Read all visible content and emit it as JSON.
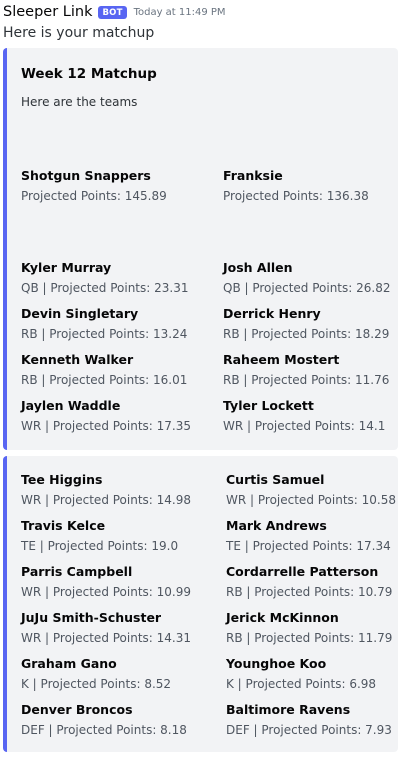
{
  "message": {
    "author": "Sleeper Link",
    "tag": "BOT",
    "timestamp": "Today at 11:49 PM",
    "content": "Here is your matchup",
    "accent_color": "#5865f2"
  },
  "embed1": {
    "title": "Week 12 Matchup",
    "description": "Here are the teams",
    "teams": [
      {
        "name": "Shotgun Snappers",
        "value": "Projected Points: 145.89"
      },
      {
        "name": "Franksie",
        "value": "Projected Points: 136.38"
      }
    ],
    "players_left": [
      {
        "name": "Kyler Murray",
        "value": "QB | Projected Points: 23.31"
      },
      {
        "name": "Devin Singletary",
        "value": "RB | Projected Points: 13.24"
      },
      {
        "name": "Kenneth Walker",
        "value": "RB | Projected Points: 16.01"
      },
      {
        "name": "Jaylen Waddle",
        "value": "WR | Projected Points: 17.35"
      }
    ],
    "players_right": [
      {
        "name": "Josh Allen",
        "value": "QB | Projected Points: 26.82"
      },
      {
        "name": "Derrick Henry",
        "value": "RB | Projected Points: 18.29"
      },
      {
        "name": "Raheem Mostert",
        "value": "RB | Projected Points: 11.76"
      },
      {
        "name": "Tyler Lockett",
        "value": "WR | Projected Points: 14.1"
      }
    ]
  },
  "embed2": {
    "players_left": [
      {
        "name": "Tee Higgins",
        "value": "WR | Projected Points: 14.98"
      },
      {
        "name": "Travis Kelce",
        "value": "TE | Projected Points: 19.0"
      },
      {
        "name": "Parris Campbell",
        "value": "WR | Projected Points: 10.99"
      },
      {
        "name": "JuJu Smith-Schuster",
        "value": "WR | Projected Points: 14.31"
      },
      {
        "name": "Graham Gano",
        "value": "K | Projected Points: 8.52"
      },
      {
        "name": "Denver Broncos",
        "value": "DEF | Projected Points: 8.18"
      }
    ],
    "players_right": [
      {
        "name": "Curtis Samuel",
        "value": "WR | Projected Points: 10.58"
      },
      {
        "name": "Mark Andrews",
        "value": "TE | Projected Points: 17.34"
      },
      {
        "name": "Cordarrelle Patterson",
        "value": "RB | Projected Points: 10.79"
      },
      {
        "name": "Jerick McKinnon",
        "value": "RB | Projected Points: 11.79"
      },
      {
        "name": "Younghoe Koo",
        "value": "K | Projected Points: 6.98"
      },
      {
        "name": "Baltimore Ravens",
        "value": "DEF | Projected Points: 7.93"
      }
    ]
  }
}
